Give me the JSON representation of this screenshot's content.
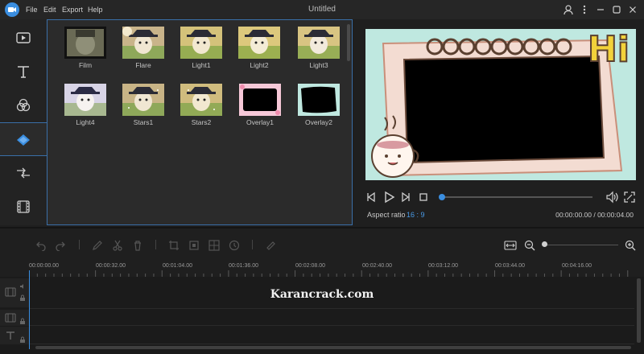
{
  "window": {
    "title": "Untitled",
    "menu": [
      "File",
      "Edit",
      "Export",
      "Help"
    ]
  },
  "left_nav": {
    "items": [
      {
        "icon": "media-icon",
        "active": false
      },
      {
        "icon": "text-icon",
        "active": false
      },
      {
        "icon": "filters-icon",
        "active": false
      },
      {
        "icon": "overlays-icon",
        "active": true
      },
      {
        "icon": "transitions-icon",
        "active": false
      },
      {
        "icon": "film-icon",
        "active": false
      }
    ]
  },
  "effects": {
    "items": [
      {
        "label": "Film"
      },
      {
        "label": "Flare"
      },
      {
        "label": "Light1"
      },
      {
        "label": "Light2"
      },
      {
        "label": "Light3"
      },
      {
        "label": "Light4"
      },
      {
        "label": "Stars1"
      },
      {
        "label": "Stars2"
      },
      {
        "label": "Overlay1"
      },
      {
        "label": "Overlay2"
      }
    ]
  },
  "preview": {
    "aspect_label": "Aspect ratio",
    "aspect_value": "16 : 9",
    "time_current": "00:00:00.00",
    "time_total": "00:00:04.00",
    "time_display": "00:00:00.00 / 00:00:04.00",
    "progress": 0.0,
    "overlay_text": "Hi"
  },
  "timeline": {
    "ruler_labels": [
      "00:00:00.00",
      "00:00:32.00",
      "00:01:04.00",
      "00:01:36.00",
      "00:02:08.00",
      "00:02:40.00",
      "00:03:12.00",
      "00:03:44.00",
      "00:04:16.00"
    ],
    "zoom_level": 0.0,
    "watermark": "Karancrack.com"
  },
  "colors": {
    "accent": "#3a8ee0",
    "panel": "#2b2b2b",
    "background": "#1f1f1f",
    "preview_bg": "#bfe8e0"
  }
}
